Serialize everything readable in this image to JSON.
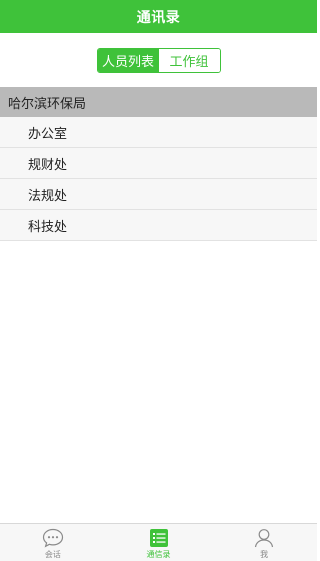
{
  "header": {
    "title": "通讯录"
  },
  "segment": {
    "active_label": "人员列表",
    "inactive_label": "工作组"
  },
  "list": {
    "group_title": "哈尔滨环保局",
    "items": [
      {
        "label": "办公室"
      },
      {
        "label": "规财处"
      },
      {
        "label": "法规处"
      },
      {
        "label": "科技处"
      }
    ]
  },
  "tabbar": {
    "tabs": [
      {
        "label": "会话",
        "icon": "chat-bubble-icon"
      },
      {
        "label": "通信录",
        "icon": "list-icon",
        "active": true
      },
      {
        "label": "我",
        "icon": "person-icon"
      }
    ]
  },
  "colors": {
    "accent": "#3fc23a",
    "group_header_bg": "#b9b9b9",
    "inactive_icon": "#8a8a8a"
  }
}
